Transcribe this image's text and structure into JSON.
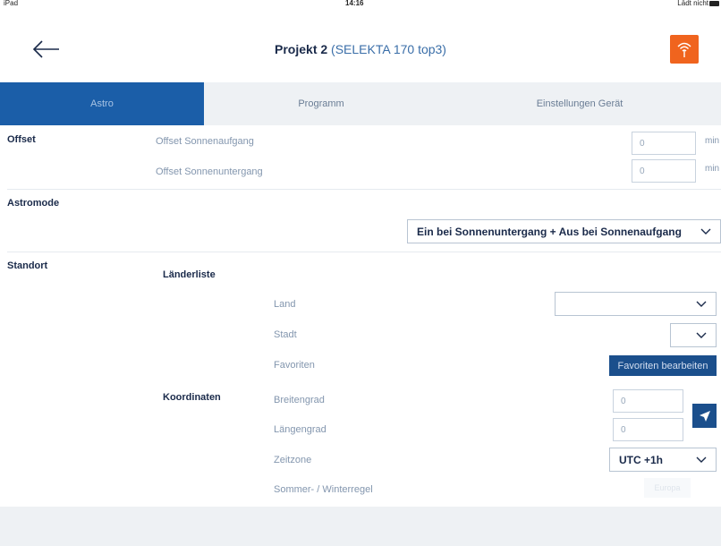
{
  "status_bar": {
    "device": "iPad",
    "time": "14:16",
    "battery": "Lädt nicht"
  },
  "header": {
    "project": "Projekt 2",
    "device_name": "(SELEKTA 170 top3)"
  },
  "tabs": [
    {
      "label": "Astro"
    },
    {
      "label": "Programm"
    },
    {
      "label": "Einstellungen Gerät"
    }
  ],
  "offset": {
    "title": "Offset",
    "sunrise_label": "Offset Sonnenaufgang",
    "sunrise_value": "0",
    "sunset_label": "Offset Sonnenuntergang",
    "sunset_value": "0",
    "unit": "min"
  },
  "astromode": {
    "title": "Astromode",
    "selected": "Ein bei Sonnenuntergang + Aus bei Sonnenaufgang"
  },
  "standort": {
    "title": "Standort",
    "laenderliste": {
      "title": "Länderliste",
      "land_label": "Land",
      "land_value": "",
      "stadt_label": "Stadt",
      "stadt_value": "",
      "favoriten_label": "Favoriten",
      "favoriten_button": "Favoriten bearbeiten"
    },
    "koordinaten": {
      "title": "Koordinaten",
      "breitengrad_label": "Breitengrad",
      "breitengrad_value": "0",
      "laengengrad_label": "Längengrad",
      "laengengrad_value": "0",
      "zeitzone_label": "Zeitzone",
      "zeitzone_value": "UTC +1h",
      "sommerwinter_label": "Sommer- / Winterregel",
      "sommerwinter_value": "Europa"
    }
  },
  "colors": {
    "accent": "#1b5ea8",
    "remote_button": "#f0641e",
    "primary_button": "#1b4f8c"
  }
}
